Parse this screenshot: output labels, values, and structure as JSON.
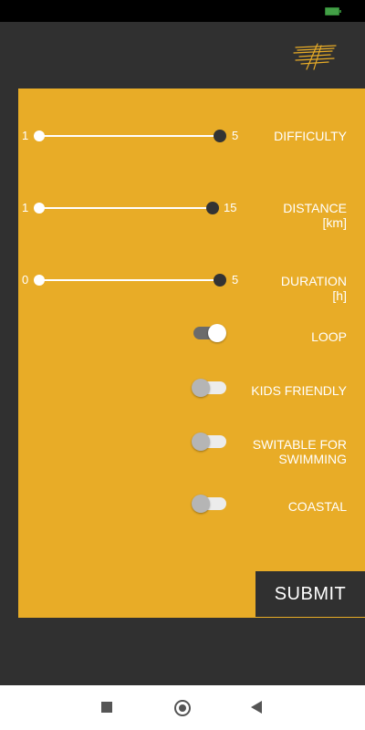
{
  "status_bar": {
    "battery_icon": "battery-icon"
  },
  "app_bar": {
    "logo_icon": "brand-logo-icon"
  },
  "filters": {
    "difficulty": {
      "label": "DIFFICULTY",
      "min_label": "1",
      "max_label": "5",
      "range": [
        1,
        5
      ]
    },
    "distance": {
      "label_line1": "DISTANCE",
      "label_line2": "[km]",
      "min_label": "1",
      "max_label": "15",
      "range": [
        1,
        15
      ]
    },
    "duration": {
      "label_line1": "DURATION",
      "label_line2": "[h]",
      "min_label": "0",
      "max_label": "5",
      "range": [
        0,
        5
      ]
    },
    "loop": {
      "label": "LOOP",
      "on": true
    },
    "kids_friendly": {
      "label": "KIDS FRIENDLY",
      "on": false
    },
    "swimming": {
      "label_line1": "SWITABLE FOR",
      "label_line2": "SWIMMING",
      "on": false
    },
    "coastal": {
      "label": "COASTAL",
      "on": false
    }
  },
  "submit": {
    "label": "SUBMIT"
  },
  "nav": {
    "recents_icon": "square-recents-icon",
    "home_icon": "circle-home-icon",
    "back_icon": "triangle-back-icon"
  },
  "colors": {
    "panel": "#e8ac27",
    "background": "#303030",
    "submit_bg": "#303030"
  }
}
